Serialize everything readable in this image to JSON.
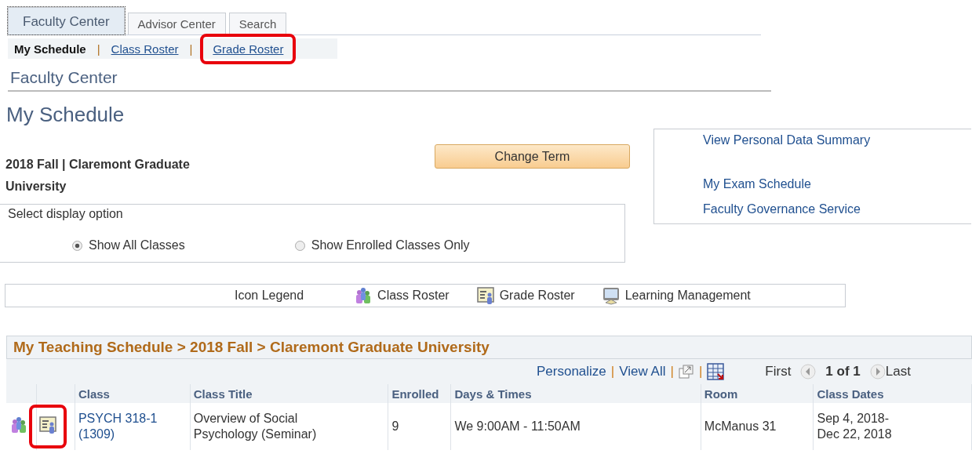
{
  "tabs": [
    {
      "label": "Faculty Center",
      "selected": true
    },
    {
      "label": "Advisor Center",
      "selected": false
    },
    {
      "label": "Search",
      "selected": false
    }
  ],
  "subnav": [
    {
      "label": "My Schedule",
      "selected": true,
      "highlighted": false
    },
    {
      "separator": "|",
      "label": "Class Roster",
      "selected": false,
      "highlighted": false
    },
    {
      "separator": "|",
      "label": "Grade Roster",
      "selected": false,
      "highlighted": true
    }
  ],
  "page_header": "Faculty Center",
  "page_title": "My Schedule",
  "term": "2018 Fall | Claremont Graduate University",
  "change_term_button": "Change Term",
  "links": [
    "View Personal Data Summary",
    "My Exam Schedule",
    "Faculty Governance Service"
  ],
  "display_option": {
    "label": "Select display option",
    "options": [
      {
        "label": "Show All Classes",
        "selected": true
      },
      {
        "label": "Show Enrolled Classes Only",
        "selected": false
      }
    ]
  },
  "legend": {
    "label": "Icon Legend",
    "items": [
      {
        "kind": "class-roster",
        "label": "Class Roster"
      },
      {
        "kind": "grade-roster",
        "label": "Grade Roster"
      },
      {
        "kind": "learning",
        "label": "Learning Management"
      }
    ]
  },
  "grid": {
    "title": "My Teaching Schedule > 2018 Fall > Claremont Graduate University",
    "toolbar": {
      "items": [
        {
          "kind": "link",
          "label": "Personalize"
        },
        {
          "kind": "separator",
          "label": "|"
        },
        {
          "kind": "link",
          "label": "View All"
        },
        {
          "kind": "separator",
          "label": "|"
        },
        {
          "kind": "zoom"
        },
        {
          "kind": "separator",
          "label": "|"
        },
        {
          "kind": "download"
        }
      ],
      "first": "First",
      "range": "1 of 1",
      "last": "Last"
    },
    "columns": [
      "Class",
      "Class Title",
      "Enrolled",
      "Days & Times",
      "Room",
      "Class Dates"
    ],
    "rows": [
      {
        "class": "PSYCH 318-1 (1309)",
        "title": "Overview of Social Psychology (Seminar)",
        "enrolled": "9",
        "days_times": "We 9:00AM - 11:50AM",
        "room": "McManus 31",
        "dates": "Sep 4, 2018- Dec 22, 2018",
        "grade_roster_highlighted": true
      }
    ]
  }
}
